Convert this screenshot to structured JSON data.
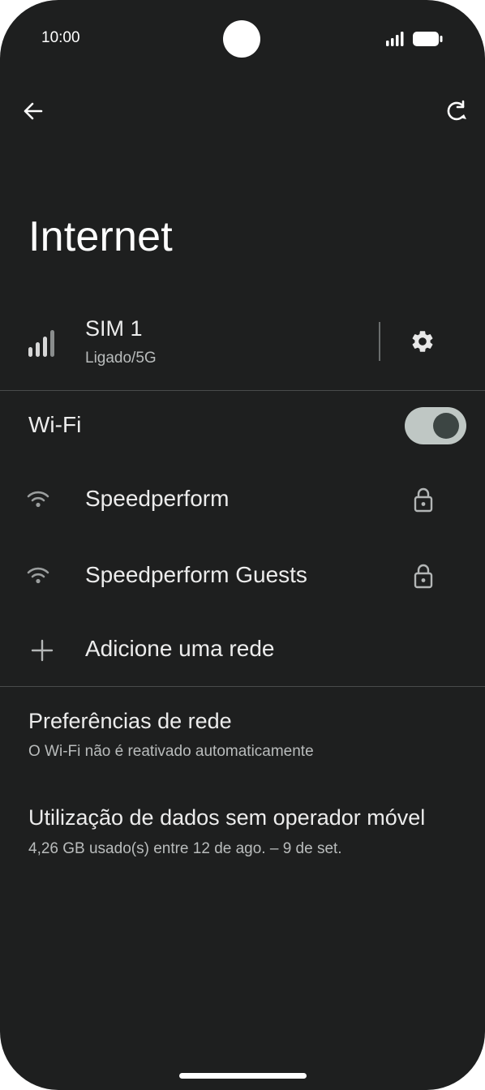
{
  "status_bar": {
    "time": "10:00",
    "signal_icon": "signal-icon",
    "battery_icon": "battery-icon"
  },
  "toolbar": {
    "back_icon": "arrow-back-icon",
    "refresh_icon": "refresh-icon"
  },
  "page": {
    "title": "Internet"
  },
  "sim": {
    "name": "SIM 1",
    "status": "Ligado/5G",
    "signal_icon": "cellular-signal-icon",
    "settings_icon": "gear-icon"
  },
  "wifi": {
    "label": "Wi-Fi",
    "enabled": true,
    "networks": [
      {
        "name": "Speedperform",
        "icon": "wifi-icon",
        "secure_icon": "lock-icon"
      },
      {
        "name": "Speedperform Guests",
        "icon": "wifi-icon",
        "secure_icon": "lock-icon"
      }
    ],
    "add_network_label": "Adicione uma rede"
  },
  "preferences": {
    "title": "Preferências de rede",
    "subtitle": "O Wi-Fi não é reativado automaticamente"
  },
  "data_usage": {
    "title": "Utilização de dados sem operador móvel",
    "subtitle": "4,26 GB usado(s) entre 12 de ago. – 9 de set."
  },
  "colors": {
    "background": "#1e1f1f",
    "text": "#ececec",
    "secondary_text": "#b9bcbc",
    "toggle_track": "#bfc7c4",
    "toggle_thumb": "#3c4543"
  }
}
